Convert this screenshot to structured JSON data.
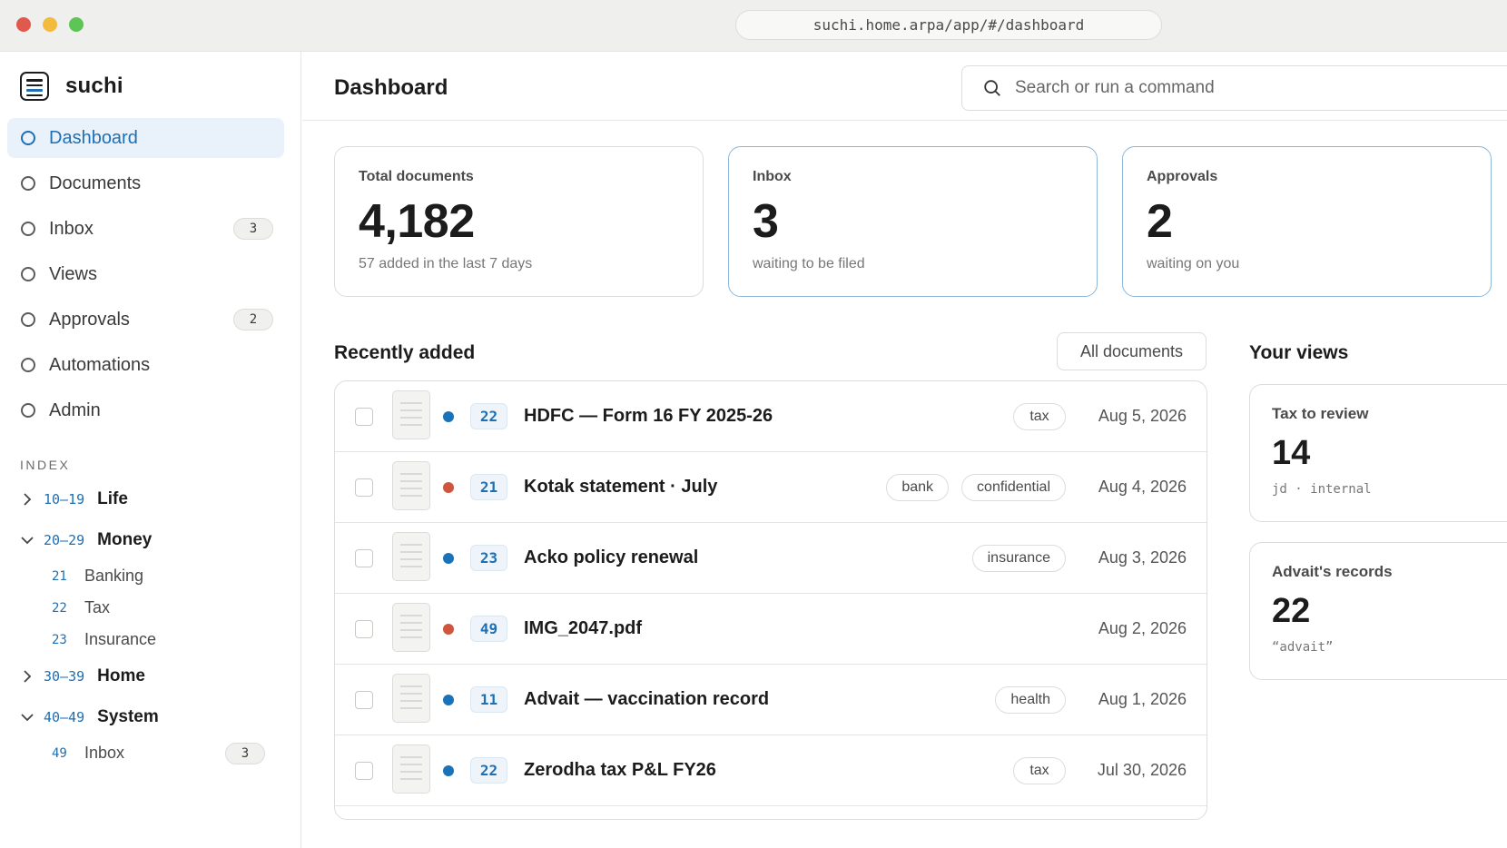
{
  "window": {
    "url": "suchi.home.arpa/app/#/dashboard"
  },
  "app": {
    "name": "suchi"
  },
  "nav": [
    {
      "label": "Dashboard",
      "active": true,
      "badge": null
    },
    {
      "label": "Documents",
      "active": false,
      "badge": null
    },
    {
      "label": "Inbox",
      "active": false,
      "badge": "3"
    },
    {
      "label": "Views",
      "active": false,
      "badge": null
    },
    {
      "label": "Approvals",
      "active": false,
      "badge": "2"
    },
    {
      "label": "Automations",
      "active": false,
      "badge": null
    },
    {
      "label": "Admin",
      "active": false,
      "badge": null
    }
  ],
  "index": {
    "title": "INDEX",
    "areas": [
      {
        "range": "10–19",
        "name": "Life",
        "expanded": false
      },
      {
        "range": "20–29",
        "name": "Money",
        "expanded": true,
        "categories": [
          {
            "code": "21",
            "name": "Banking"
          },
          {
            "code": "22",
            "name": "Tax"
          },
          {
            "code": "23",
            "name": "Insurance"
          }
        ]
      },
      {
        "range": "30–39",
        "name": "Home",
        "expanded": false
      },
      {
        "range": "40–49",
        "name": "System",
        "expanded": true,
        "categories": [
          {
            "code": "49",
            "name": "Inbox",
            "badge": "3"
          }
        ]
      }
    ]
  },
  "header": {
    "title": "Dashboard",
    "search_placeholder": "Search or run a command"
  },
  "stats": [
    {
      "label": "Total documents",
      "value": "4,182",
      "note": "57 added in the last 7 days",
      "highlight": false
    },
    {
      "label": "Inbox",
      "value": "3",
      "note": "waiting to be filed",
      "highlight": true
    },
    {
      "label": "Approvals",
      "value": "2",
      "note": "waiting on you",
      "highlight": true
    }
  ],
  "recent": {
    "title": "Recently added",
    "all_button": "All documents",
    "rows": [
      {
        "status_color": "#1a73b8",
        "code": "22",
        "title": "HDFC — Form 16 FY 2025-26",
        "tags": [
          "tax"
        ],
        "date": "Aug 5, 2026"
      },
      {
        "status_color": "#d0553f",
        "code": "21",
        "title": "Kotak statement · July",
        "tags": [
          "bank",
          "confidential"
        ],
        "date": "Aug 4, 2026"
      },
      {
        "status_color": "#1a73b8",
        "code": "23",
        "title": "Acko policy renewal",
        "tags": [
          "insurance"
        ],
        "date": "Aug 3, 2026"
      },
      {
        "status_color": "#d0553f",
        "code": "49",
        "title": "IMG_2047.pdf",
        "tags": [],
        "date": "Aug 2, 2026"
      },
      {
        "status_color": "#1a73b8",
        "code": "11",
        "title": "Advait — vaccination record",
        "tags": [
          "health"
        ],
        "date": "Aug 1, 2026"
      },
      {
        "status_color": "#1a73b8",
        "code": "22",
        "title": "Zerodha tax P&L FY26",
        "tags": [
          "tax"
        ],
        "date": "Jul 30, 2026"
      }
    ]
  },
  "views": {
    "title": "Your views",
    "items": [
      {
        "title": "Tax to review",
        "count": "14",
        "meta": "jd · internal"
      },
      {
        "title": "Advait's records",
        "count": "22",
        "meta": "“advait”"
      }
    ]
  },
  "colors": {
    "accent": "#1e6fb3",
    "active_bg": "#e9f2fa"
  }
}
